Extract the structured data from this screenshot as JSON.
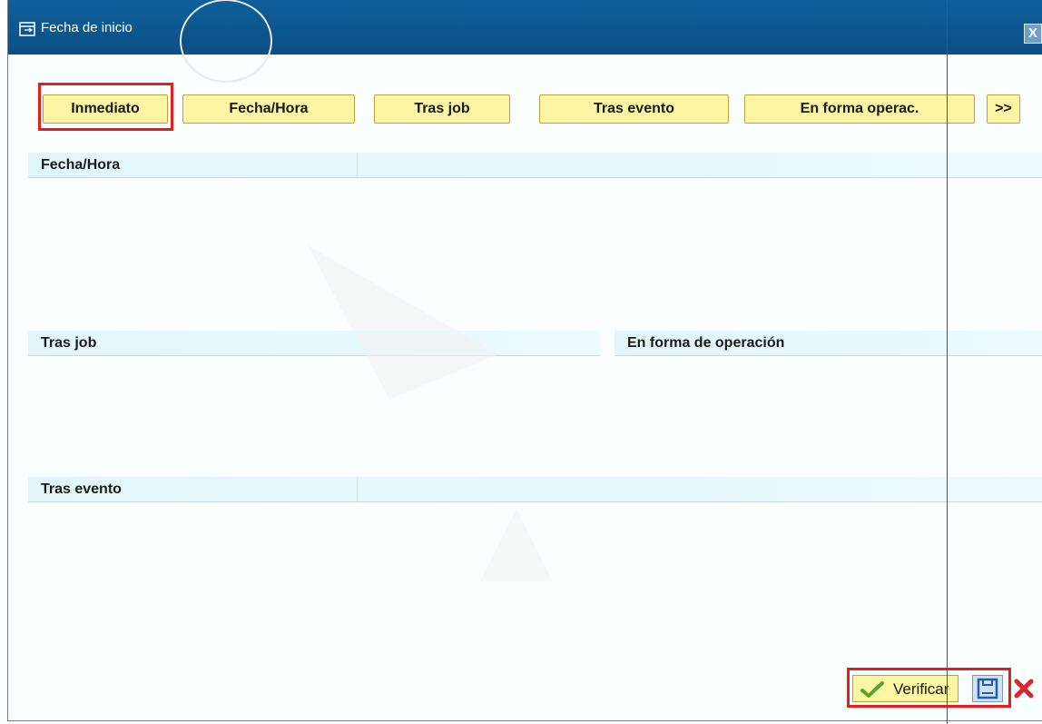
{
  "window": {
    "title": "Fecha de inicio",
    "close_label": "X"
  },
  "tabs": [
    {
      "label": "Inmediato",
      "highlighted": true
    },
    {
      "label": "Fecha/Hora"
    },
    {
      "label": "Tras job"
    },
    {
      "label": "Tras evento"
    },
    {
      "label": "En forma operac."
    },
    {
      "label": ">>"
    }
  ],
  "groups": {
    "fecha_hora": "Fecha/Hora",
    "tras_job": "Tras job",
    "en_forma": "En forma de operación",
    "tras_evento": "Tras evento"
  },
  "footer": {
    "verify_label": "Verificar",
    "save_icon": "save-icon",
    "cancel_icon": "cancel-icon"
  },
  "colors": {
    "titlebar": "#0b4f85",
    "button_face": "#fbf5a4",
    "highlight": "#e11f1f",
    "group_header": "#e1f6fb"
  }
}
